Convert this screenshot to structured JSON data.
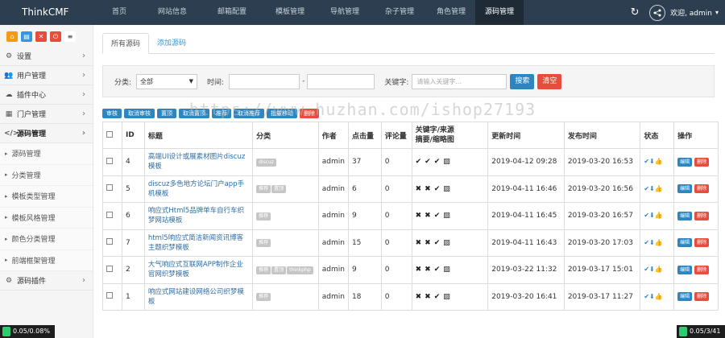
{
  "brand": "ThinkCMF",
  "topnav": [
    {
      "label": "首页",
      "width": 0
    },
    {
      "label": "网站信息"
    },
    {
      "label": "邮箱配置"
    },
    {
      "label": "模板管理"
    },
    {
      "label": "导航管理"
    },
    {
      "label": "杂子管理"
    },
    {
      "label": "角色管理"
    },
    {
      "label": "源码管理"
    }
  ],
  "user": {
    "greeting": "欢迎, admin",
    "caret": "▾"
  },
  "sidebar": {
    "items": [
      {
        "label": "设置"
      },
      {
        "label": "用户管理"
      },
      {
        "label": "插件中心"
      },
      {
        "label": "门户管理"
      },
      {
        "label": "源码管理"
      }
    ],
    "sub_items": [
      {
        "label": "源码管理"
      },
      {
        "label": "分类管理"
      },
      {
        "label": "模板类型管理"
      },
      {
        "label": "模板风格管理"
      },
      {
        "label": "颜色分类管理"
      },
      {
        "label": "前端框架管理"
      }
    ],
    "last_item": {
      "label": "源码插件"
    }
  },
  "tabs": [
    {
      "label": "所有源码"
    },
    {
      "label": "添加源码"
    }
  ],
  "filter": {
    "category_label": "分类:",
    "category_value": "全部",
    "time_label": "时间:",
    "dash": "-",
    "keyword_label": "关键字:",
    "keyword_placeholder": "请输入关键字...",
    "search_label": "搜索",
    "clear_label": "清空"
  },
  "batch": [
    "审核",
    "取消审核",
    "置顶",
    "取消置顶",
    "推荐",
    "取消推荐",
    "批量移动",
    "删除"
  ],
  "table": {
    "headers": {
      "id": "ID",
      "title": "标题",
      "category": "分类",
      "author": "作者",
      "hits": "点击量",
      "comments": "评论量",
      "kw_line1": "关键字/来源",
      "kw_line2": "摘要/缩略图",
      "updated": "更新时间",
      "published": "发布时间",
      "status": "状态",
      "actions": "操作"
    },
    "rows": [
      {
        "id": "4",
        "title": "高端UI设计或展素材图片discuz模板",
        "tags": [
          "discuz"
        ],
        "author": "admin",
        "hits": "37",
        "comments": "0",
        "kw": "✔✔✔",
        "updated": "2019-04-12 09:28",
        "published": "2019-03-20 16:53"
      },
      {
        "id": "5",
        "title": "discuz多色地方论坛门户app手机模板",
        "tags": [
          "推荐",
          "置顶"
        ],
        "author": "admin",
        "hits": "6",
        "comments": "0",
        "kw": "✖✖✔",
        "updated": "2019-04-11 16:46",
        "published": "2019-03-20 16:56"
      },
      {
        "id": "6",
        "title": "响应式Html5品牌单车自行车织梦网站模板",
        "tags": [
          "推荐"
        ],
        "author": "admin",
        "hits": "9",
        "comments": "0",
        "kw": "✖✖✔",
        "updated": "2019-04-11 16:45",
        "published": "2019-03-20 16:57"
      },
      {
        "id": "7",
        "title": "html5响应式简洁新闻资讯博客主题织梦模板",
        "tags": [
          "推荐"
        ],
        "author": "admin",
        "hits": "15",
        "comments": "0",
        "kw": "✖✖✔",
        "updated": "2019-04-11 16:43",
        "published": "2019-03-20 17:03"
      },
      {
        "id": "2",
        "title": "大气响应式互联网APP制作企业官网织梦模板",
        "tags": [
          "推荐",
          "置顶",
          "thinkphp"
        ],
        "author": "admin",
        "hits": "9",
        "comments": "0",
        "kw": "✖✖✔",
        "updated": "2019-03-22 11:32",
        "published": "2019-03-17 15:01"
      },
      {
        "id": "1",
        "title": "响应式网站建设网络公司织梦模板",
        "tags": [
          "推荐"
        ],
        "author": "admin",
        "hits": "18",
        "comments": "0",
        "kw": "✖✖✔",
        "updated": "2019-03-20 16:41",
        "published": "2019-03-17 11:27"
      }
    ],
    "edit_label": "编辑",
    "delete_label": "删除"
  },
  "watermark": "https://www.huzhan.com/ishop27193",
  "gauges": {
    "left": "0.05/0.08%",
    "right": "0.05/3/41"
  }
}
